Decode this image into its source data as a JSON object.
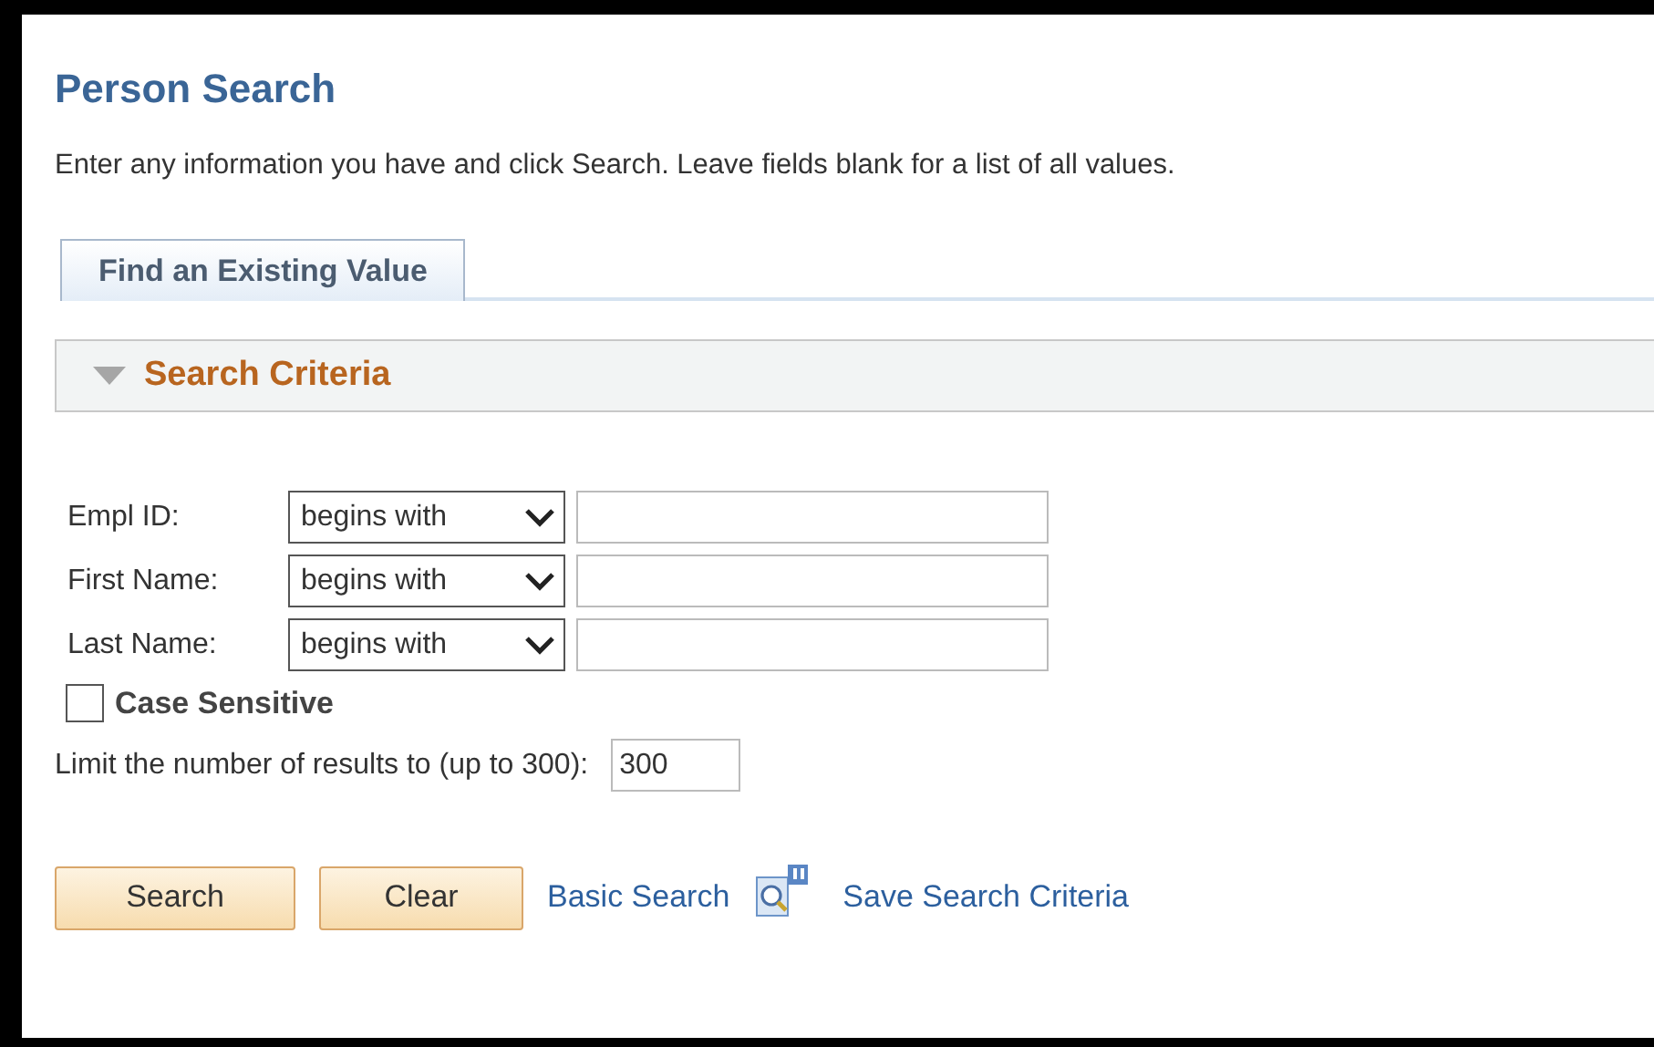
{
  "page": {
    "title": "Person Search",
    "instructions": "Enter any information you have and click Search. Leave fields blank for a list of all values."
  },
  "tabs": [
    {
      "label": "Find an Existing Value",
      "selected": true
    }
  ],
  "section": {
    "title": "Search Criteria",
    "expanded": true
  },
  "criteria": [
    {
      "label": "Empl ID:",
      "operator": "begins with"
    },
    {
      "label": "First Name:",
      "operator": "begins with"
    },
    {
      "label": "Last Name:",
      "operator": "begins with"
    }
  ],
  "case_sensitive": {
    "label": "Case Sensitive",
    "checked": false
  },
  "limit": {
    "label": "Limit the number of results to (up to 300):",
    "value": "300"
  },
  "buttons": [
    "Search",
    "Clear"
  ],
  "links": [
    {
      "label": "Basic Search",
      "kind": "text"
    },
    {
      "label": "Save Search Criteria",
      "kind": "icon"
    }
  ]
}
